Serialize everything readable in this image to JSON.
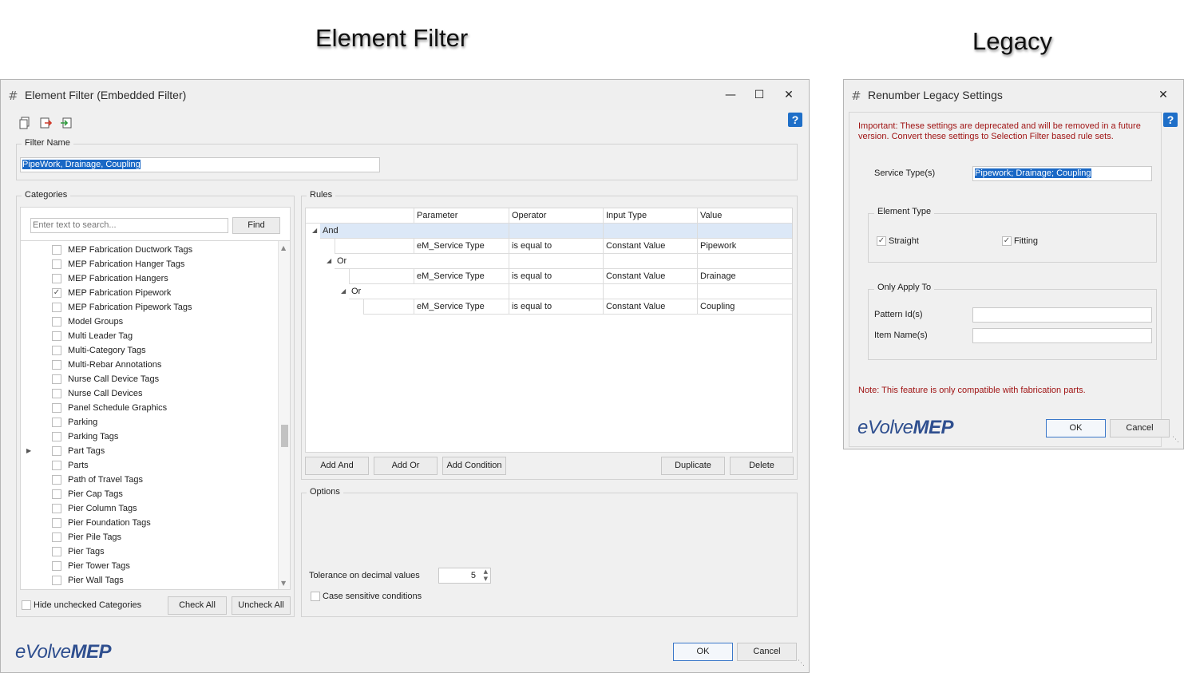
{
  "headings": {
    "left": "Element Filter",
    "right": "Legacy"
  },
  "element_filter": {
    "window_title": "Element Filter (Embedded Filter)",
    "filter_name_label": "Filter Name",
    "filter_name_value": "PipeWork, Drainage, Coupling",
    "categories": {
      "label": "Categories",
      "search_placeholder": "Enter text to search...",
      "find_label": "Find",
      "items": [
        {
          "label": "MEP Fabrication Ductwork Tags",
          "checked": false
        },
        {
          "label": "MEP Fabrication Hanger Tags",
          "checked": false
        },
        {
          "label": "MEP Fabrication Hangers",
          "checked": false
        },
        {
          "label": "MEP Fabrication Pipework",
          "checked": true
        },
        {
          "label": "MEP Fabrication Pipework Tags",
          "checked": false
        },
        {
          "label": "Model Groups",
          "checked": false
        },
        {
          "label": "Multi Leader Tag",
          "checked": false
        },
        {
          "label": "Multi-Category Tags",
          "checked": false
        },
        {
          "label": "Multi-Rebar Annotations",
          "checked": false
        },
        {
          "label": "Nurse Call Device Tags",
          "checked": false
        },
        {
          "label": "Nurse Call Devices",
          "checked": false
        },
        {
          "label": "Panel Schedule Graphics",
          "checked": false
        },
        {
          "label": "Parking",
          "checked": false
        },
        {
          "label": "Parking Tags",
          "checked": false
        },
        {
          "label": "Part Tags",
          "checked": false
        },
        {
          "label": "Parts",
          "checked": false
        },
        {
          "label": "Path of Travel Tags",
          "checked": false
        },
        {
          "label": "Pier Cap Tags",
          "checked": false
        },
        {
          "label": "Pier Column Tags",
          "checked": false
        },
        {
          "label": "Pier Foundation Tags",
          "checked": false
        },
        {
          "label": "Pier Pile Tags",
          "checked": false
        },
        {
          "label": "Pier Tags",
          "checked": false
        },
        {
          "label": "Pier Tower Tags",
          "checked": false
        },
        {
          "label": "Pier Wall Tags",
          "checked": false
        }
      ],
      "hide_unchecked_label": "Hide unchecked Categories",
      "check_all_label": "Check All",
      "uncheck_all_label": "Uncheck All"
    },
    "rules": {
      "label": "Rules",
      "columns": [
        "Parameter",
        "Operator",
        "Input Type",
        "Value"
      ],
      "rows": [
        {
          "kind": "group",
          "label": "And",
          "level": 0
        },
        {
          "kind": "cond",
          "parameter": "eM_Service Type",
          "operator": "is equal to",
          "input_type": "Constant Value",
          "value": "Pipework"
        },
        {
          "kind": "group",
          "label": "Or",
          "level": 1
        },
        {
          "kind": "cond",
          "parameter": "eM_Service Type",
          "operator": "is equal to",
          "input_type": "Constant Value",
          "value": "Drainage"
        },
        {
          "kind": "group",
          "label": "Or",
          "level": 2
        },
        {
          "kind": "cond",
          "parameter": "eM_Service Type",
          "operator": "is equal to",
          "input_type": "Constant Value",
          "value": "Coupling"
        }
      ],
      "add_and_label": "Add And",
      "add_or_label": "Add Or",
      "add_condition_label": "Add Condition",
      "duplicate_label": "Duplicate",
      "delete_label": "Delete"
    },
    "options": {
      "label": "Options",
      "tolerance_label": "Tolerance on decimal values",
      "tolerance_value": "5",
      "case_sensitive_label": "Case sensitive conditions"
    },
    "ok_label": "OK",
    "cancel_label": "Cancel"
  },
  "legacy": {
    "window_title": "Renumber Legacy Settings",
    "warning": "Important: These settings are deprecated and will be removed in a future version. Convert these settings to Selection Filter based rule sets.",
    "service_types_label": "Service Type(s)",
    "service_types_value": "Pipework; Drainage; Coupling",
    "element_type": {
      "label": "Element Type",
      "straight_label": "Straight",
      "fitting_label": "Fitting"
    },
    "only_apply_to": {
      "label": "Only Apply To",
      "pattern_ids_label": "Pattern Id(s)",
      "item_names_label": "Item Name(s)"
    },
    "note": "Note: This feature is only compatible with fabrication parts.",
    "ok_label": "OK",
    "cancel_label": "Cancel"
  },
  "brand": {
    "prefix": "eVolve",
    "suffix": "MEP",
    "color": "#2f4f8f"
  },
  "help_label": "?"
}
